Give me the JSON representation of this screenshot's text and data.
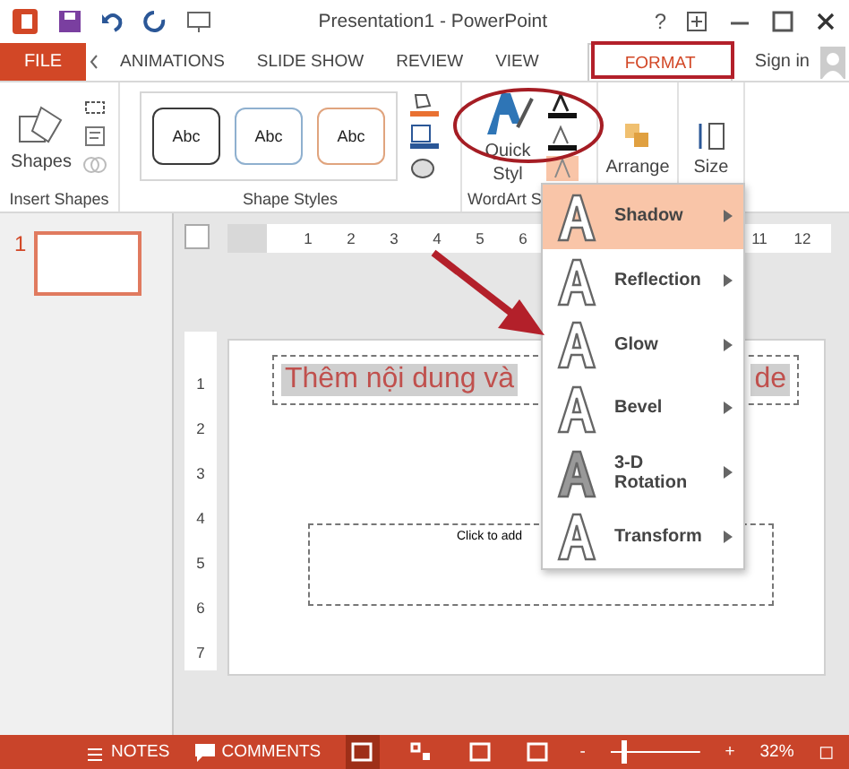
{
  "title_bar": {
    "title": "Presentation1 - PowerPoint",
    "help": "?"
  },
  "ribbon_tabs": [
    {
      "label": "FILE",
      "kind": "file",
      "selected": false
    },
    {
      "label": "ANIMATIONS",
      "kind": "tab",
      "selected": false
    },
    {
      "label": "SLIDE SHOW",
      "kind": "tab",
      "selected": false
    },
    {
      "label": "REVIEW",
      "kind": "tab",
      "selected": false
    },
    {
      "label": "VIEW",
      "kind": "tab",
      "selected": false
    },
    {
      "label": "FORMAT",
      "kind": "tab",
      "selected": true
    }
  ],
  "sign_in": "Sign in",
  "ribbon": {
    "insert_shapes": {
      "label": "Insert Shapes",
      "shapes": "Shapes"
    },
    "shape_styles": {
      "label": "Shape Styles",
      "swatches": [
        {
          "label": "Abc",
          "color": "#3a3a3a"
        },
        {
          "label": "Abc",
          "color": "#8fb0cf"
        },
        {
          "label": "Abc",
          "color": "#e0a47e"
        }
      ]
    },
    "wordart_styles": {
      "label": "WordArt S",
      "quick_styles": [
        "Quick",
        "Styl"
      ]
    },
    "arrange": "Arrange",
    "size": "Size"
  },
  "slides_panel": [
    {
      "number": "1",
      "selected": true
    }
  ],
  "ruler": {
    "horizontal": [
      "1",
      "2",
      "3",
      "4",
      "5",
      "6",
      "11",
      "12"
    ],
    "vertical": [
      "1",
      "2",
      "3",
      "4",
      "5",
      "6",
      "7"
    ]
  },
  "slide": {
    "title_start": "Thêm nội dung và",
    "title_end": "de",
    "body": "Click to add"
  },
  "menu": [
    {
      "label": "Shadow",
      "selected": true
    },
    {
      "label": "Reflection",
      "selected": false
    },
    {
      "label": "Glow",
      "selected": false
    },
    {
      "label": "Bevel",
      "selected": false
    },
    {
      "label": "3-D Rotation",
      "selected": false
    },
    {
      "label": "Transform",
      "selected": false
    }
  ],
  "annotations": [
    {
      "kind": "ellipse"
    },
    {
      "kind": "arrow"
    },
    {
      "kind": "frame"
    }
  ],
  "status_bar": {
    "notes": "NOTES",
    "comments": "COMMENTS",
    "views": [
      {
        "selected": true
      },
      {
        "selected": false
      },
      {
        "selected": false
      },
      {
        "selected": false
      }
    ],
    "zoom_out": "-",
    "zoom": {
      "level": 0.13
    },
    "zoom_in": "+",
    "zoom_text": "32%"
  }
}
